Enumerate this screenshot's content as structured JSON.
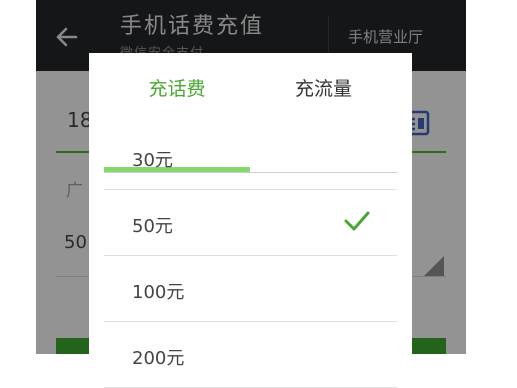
{
  "header": {
    "title": "手机话费充值",
    "subtitle": "微信安全支付",
    "hall_link": "手机营业厅"
  },
  "form": {
    "phone_partial": "18",
    "area_partial": "广",
    "amount_partial": "50"
  },
  "dialog": {
    "tabs": [
      {
        "label": "充话费",
        "active": true
      },
      {
        "label": "充流量",
        "active": false
      }
    ],
    "options": [
      {
        "label": "30元",
        "selected": false
      },
      {
        "label": "50元",
        "selected": true
      },
      {
        "label": "100元",
        "selected": false
      },
      {
        "label": "200元",
        "selected": false
      }
    ]
  },
  "colors": {
    "accent": "#49a832",
    "titlebar": "#222528"
  }
}
